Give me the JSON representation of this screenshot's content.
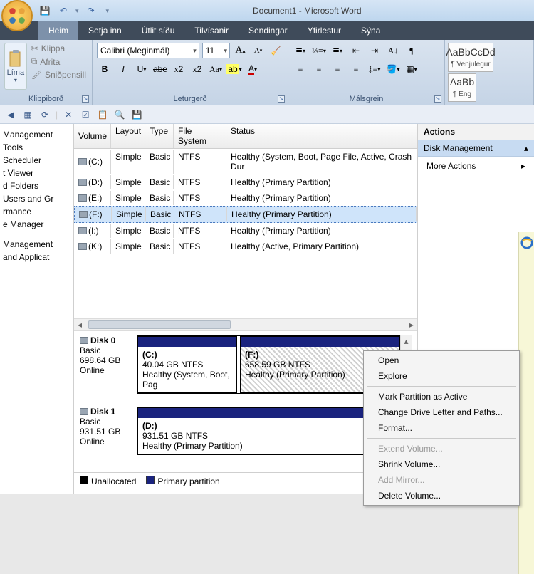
{
  "title": "Document1 - Microsoft Word",
  "qat": {
    "save": "💾",
    "undo": "↶",
    "redo": "↷"
  },
  "tabs": [
    "Heim",
    "Setja inn",
    "Útlit síðu",
    "Tilvísanir",
    "Sendingar",
    "Yfirlestur",
    "Sýna"
  ],
  "clipboard": {
    "paste": "Líma",
    "cut": "Klippa",
    "copy": "Afrita",
    "painter": "Sniðpensill",
    "group": "Klippiborð"
  },
  "font": {
    "name": "Calibri (Meginmál)",
    "size": "11",
    "group": "Leturgerð"
  },
  "para": {
    "group": "Málsgrein"
  },
  "styles": [
    {
      "sample": "AaBbCcDd",
      "name": "¶ Venjulegur"
    },
    {
      "sample": "AaBb",
      "name": "¶ Eng"
    }
  ],
  "dm": {
    "leftItems1": [
      "Management",
      "Tools",
      "Scheduler",
      "t Viewer",
      "d Folders",
      "Users and Gr",
      "rmance",
      "e Manager"
    ],
    "leftItems2": [
      "Management",
      "and Applicat"
    ],
    "cols": [
      "Volume",
      "Layout",
      "Type",
      "File System",
      "Status"
    ],
    "rows": [
      {
        "v": "(C:)",
        "l": "Simple",
        "t": "Basic",
        "fs": "NTFS",
        "s": "Healthy (System, Boot, Page File, Active, Crash Dur"
      },
      {
        "v": "(D:)",
        "l": "Simple",
        "t": "Basic",
        "fs": "NTFS",
        "s": "Healthy (Primary Partition)"
      },
      {
        "v": "(E:)",
        "l": "Simple",
        "t": "Basic",
        "fs": "NTFS",
        "s": "Healthy (Primary Partition)"
      },
      {
        "v": "(F:)",
        "l": "Simple",
        "t": "Basic",
        "fs": "NTFS",
        "s": "Healthy (Primary Partition)",
        "sel": true
      },
      {
        "v": "(I:)",
        "l": "Simple",
        "t": "Basic",
        "fs": "NTFS",
        "s": "Healthy (Primary Partition)"
      },
      {
        "v": "(K:)",
        "l": "Simple",
        "t": "Basic",
        "fs": "NTFS",
        "s": "Healthy (Active, Primary Partition)"
      }
    ],
    "actions": {
      "hdr": "Actions",
      "sub": "Disk Management",
      "more": "More Actions"
    },
    "disk0": {
      "name": "Disk 0",
      "type": "Basic",
      "size": "698.64 GB",
      "state": "Online",
      "p1": {
        "label": "(C:)",
        "size": "40.04 GB NTFS",
        "status": "Healthy (System, Boot, Pag"
      },
      "p2": {
        "label": "(F:)",
        "size": "658.59 GB NTFS",
        "status": "Healthy (Primary Partition)"
      }
    },
    "disk1": {
      "name": "Disk 1",
      "type": "Basic",
      "size": "931.51 GB",
      "state": "Online",
      "p1": {
        "label": "(D:)",
        "size": "931.51 GB NTFS",
        "status": "Healthy (Primary Partition)"
      }
    },
    "legend": {
      "un": "Unallocated",
      "pp": "Primary partition"
    }
  },
  "ctx": [
    {
      "t": "Open",
      "e": true
    },
    {
      "t": "Explore",
      "e": true
    },
    {
      "sep": true
    },
    {
      "t": "Mark Partition as Active",
      "e": true
    },
    {
      "t": "Change Drive Letter and Paths...",
      "e": true
    },
    {
      "t": "Format...",
      "e": true
    },
    {
      "sep": true
    },
    {
      "t": "Extend Volume...",
      "e": false
    },
    {
      "t": "Shrink Volume...",
      "e": true
    },
    {
      "t": "Add Mirror...",
      "e": false
    },
    {
      "t": "Delete Volume...",
      "e": true
    }
  ]
}
